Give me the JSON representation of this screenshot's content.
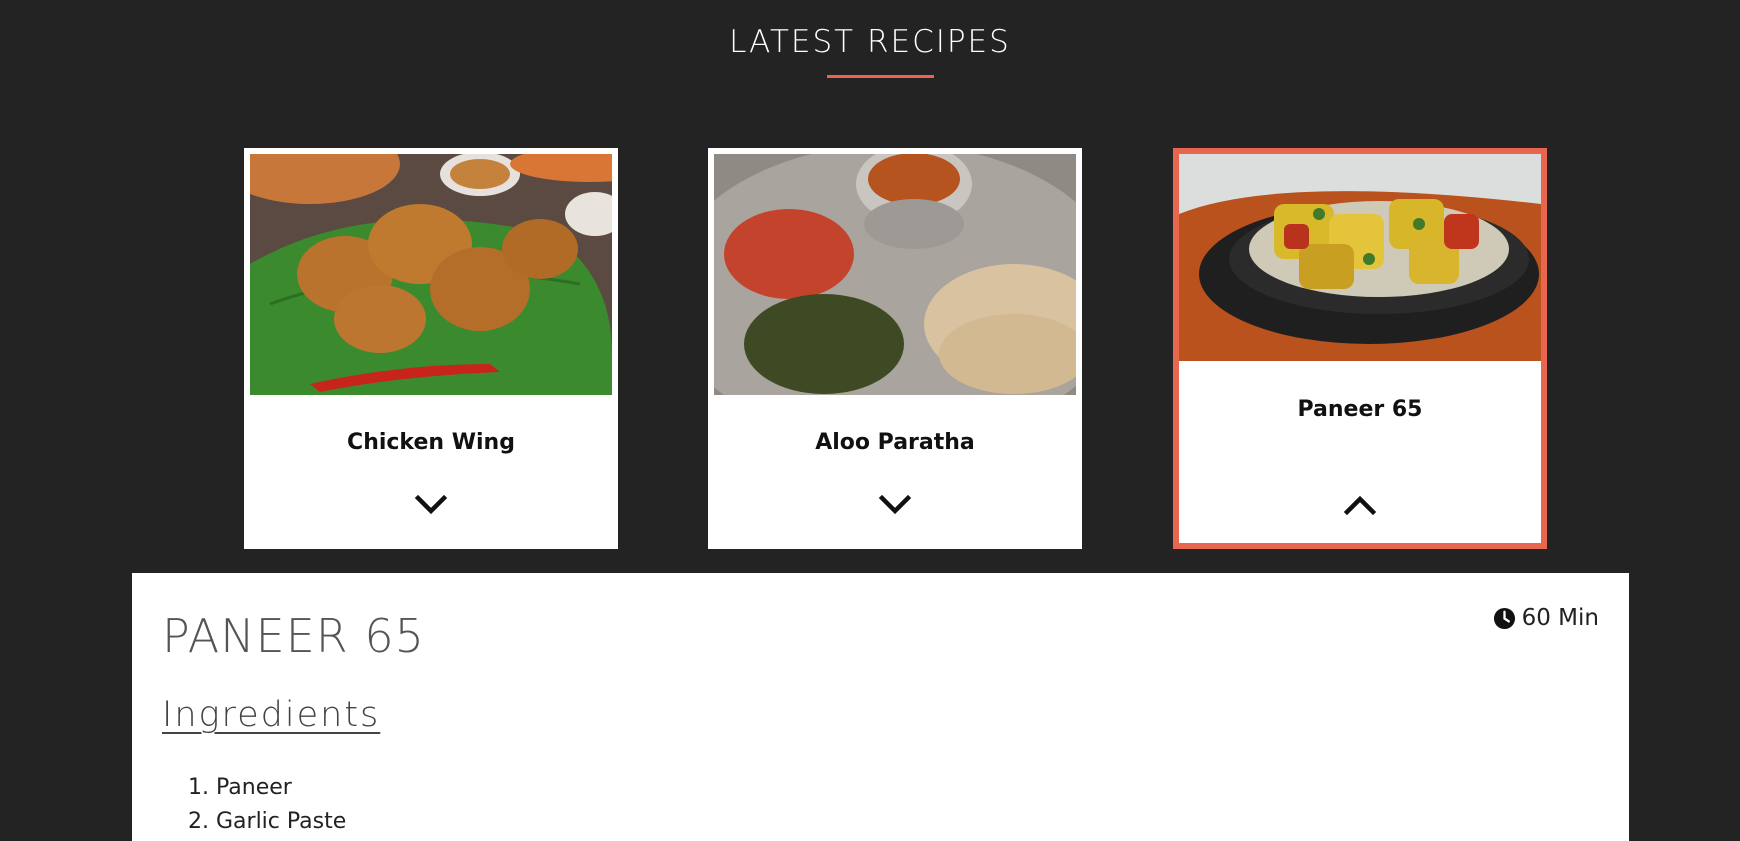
{
  "header": {
    "title": "LATEST RECIPES"
  },
  "colors": {
    "accent": "#e8654e",
    "background": "#232323",
    "card": "#ffffff"
  },
  "cards": [
    {
      "name": "Chicken Wing",
      "toggle_icon": "chevron-down-icon",
      "expanded": false
    },
    {
      "name": "Aloo Paratha",
      "toggle_icon": "chevron-down-icon",
      "expanded": false
    },
    {
      "name": "Paneer 65",
      "toggle_icon": "chevron-up-icon",
      "expanded": true
    }
  ],
  "detail": {
    "title": "PANEER 65",
    "time_icon": "clock-icon",
    "time": "60 Min",
    "ingredients_heading": "Ingredients",
    "ingredients": [
      "Paneer",
      "Garlic Paste"
    ]
  }
}
